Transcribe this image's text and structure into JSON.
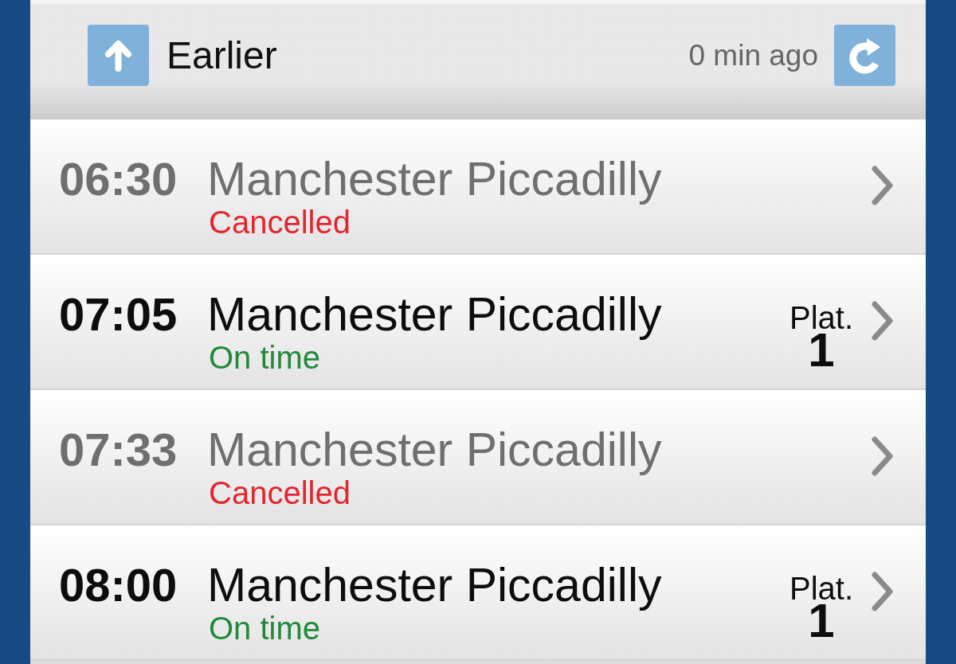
{
  "header": {
    "earlier": {
      "label": "Earlier"
    },
    "updated": "0 min ago"
  },
  "departures": [
    {
      "time": "06:30",
      "destination": "Manchester Piccadilly",
      "status": {
        "kind": "cancelled",
        "text": "Cancelled"
      }
    },
    {
      "time": "07:05",
      "destination": "Manchester Piccadilly",
      "status": {
        "kind": "on_time",
        "text": "On time"
      },
      "platform": {
        "label": "Plat.",
        "number": "1"
      }
    },
    {
      "time": "07:33",
      "destination": "Manchester Piccadilly",
      "status": {
        "kind": "cancelled",
        "text": "Cancelled"
      }
    },
    {
      "time": "08:00",
      "destination": "Manchester Piccadilly",
      "status": {
        "kind": "on_time",
        "text": "On time"
      },
      "platform": {
        "label": "Plat.",
        "number": "1"
      }
    }
  ]
}
